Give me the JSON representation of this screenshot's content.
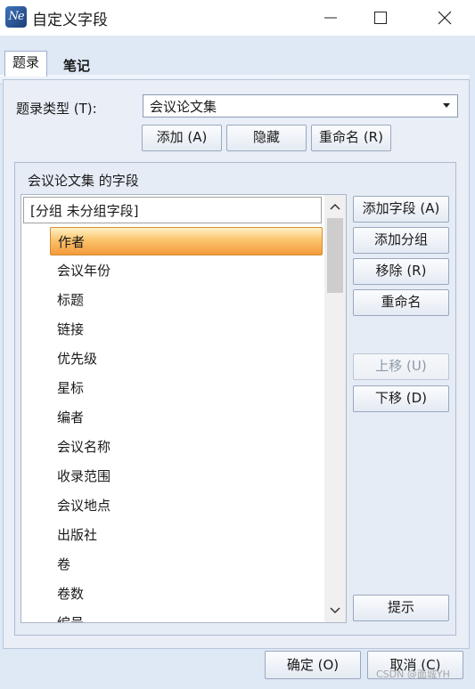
{
  "window": {
    "title": "自定义字段",
    "app_icon_text": "Ne"
  },
  "tabs": [
    {
      "label": "题录"
    },
    {
      "label": "笔记"
    }
  ],
  "record_type": {
    "label": "题录类型 (T):",
    "value": "会议论文集"
  },
  "type_buttons": {
    "add": "添加 (A)",
    "hide": "隐藏",
    "rename": "重命名 (R)"
  },
  "fields_group": {
    "title": "会议论文集 的字段",
    "group_header": "[分组 未分组字段]",
    "fields": [
      "作者",
      "会议年份",
      "标题",
      "链接",
      "优先级",
      "星标",
      "编者",
      "会议名称",
      "收录范围",
      "会议地点",
      "出版社",
      "卷",
      "卷数",
      "编号"
    ],
    "selected_index": 0
  },
  "field_buttons": {
    "add_field": "添加字段 (A)",
    "add_group": "添加分组",
    "remove": "移除 (R)",
    "rename": "重命名",
    "move_up": "上移 (U)",
    "move_down": "下移 (D)",
    "hint": "提示"
  },
  "dialog_buttons": {
    "ok": "确定 (O)",
    "cancel": "取消 (C)"
  },
  "watermark": "CSDN @面城YH",
  "colors": {
    "selection": "#f7a848",
    "panel": "#e9eef7",
    "accent": "#2c5aa0"
  }
}
